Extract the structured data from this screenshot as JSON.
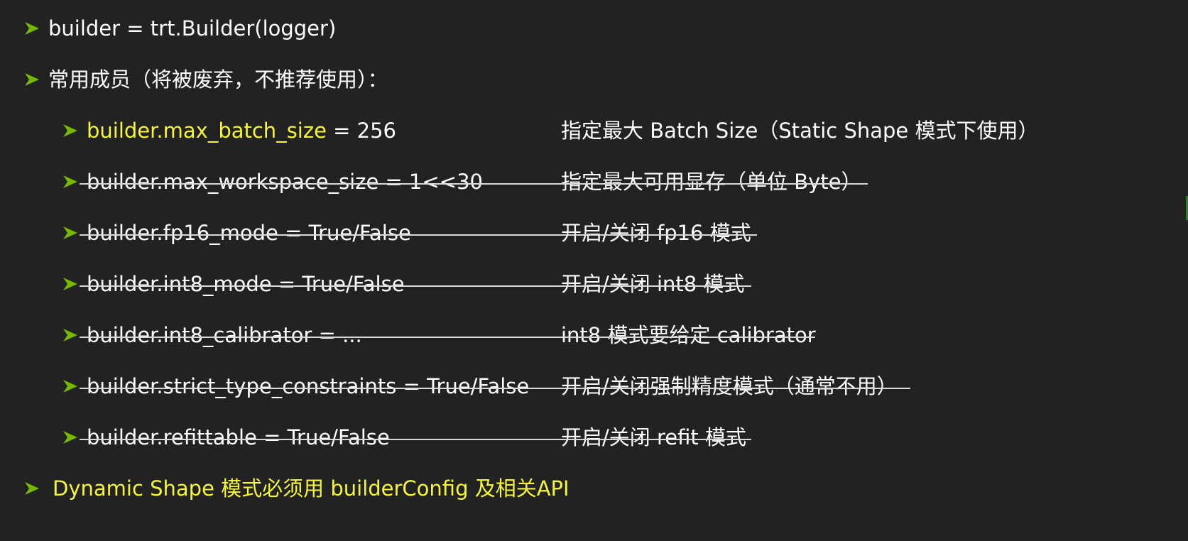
{
  "colors": {
    "background": "#222222",
    "bullet": "#76b900",
    "highlight": "#f5f53a",
    "text": "#ffffff",
    "strike": "#d8d8d8"
  },
  "bullet_icon": "arrow-bullet-icon",
  "items": [
    {
      "main": "builder = trt.Builder(logger)"
    },
    {
      "main": "常用成员（将被废弃，不推荐使用）："
    }
  ],
  "members": [
    {
      "code": "builder.max_batch_size",
      "value": " = 256",
      "desc": "指定最大 Batch Size（Static Shape 模式下使用）",
      "deprecated": false
    },
    {
      "code": "builder.max_workspace_size = 1<<30",
      "desc": "指定最大可用显存（单位 Byte）",
      "deprecated": true
    },
    {
      "code": "builder.fp16_mode = True/False",
      "desc": "开启/关闭 fp16 模式",
      "deprecated": true
    },
    {
      "code": "builder.int8_mode = True/False",
      "desc": "开启/关闭 int8 模式",
      "deprecated": true
    },
    {
      "code": "builder.int8_calibrator = ...",
      "desc": "int8 模式要给定 calibrator",
      "deprecated": true
    },
    {
      "code": "builder.strict_type_constraints  = True/False",
      "desc": "开启/关闭强制精度模式（通常不用）",
      "deprecated": true
    },
    {
      "code": "builder.refittable = True/False",
      "desc": "开启/关闭 refit 模式",
      "deprecated": true
    }
  ],
  "footer": {
    "text": "Dynamic Shape 模式必须用 builderConfig 及相关API"
  }
}
